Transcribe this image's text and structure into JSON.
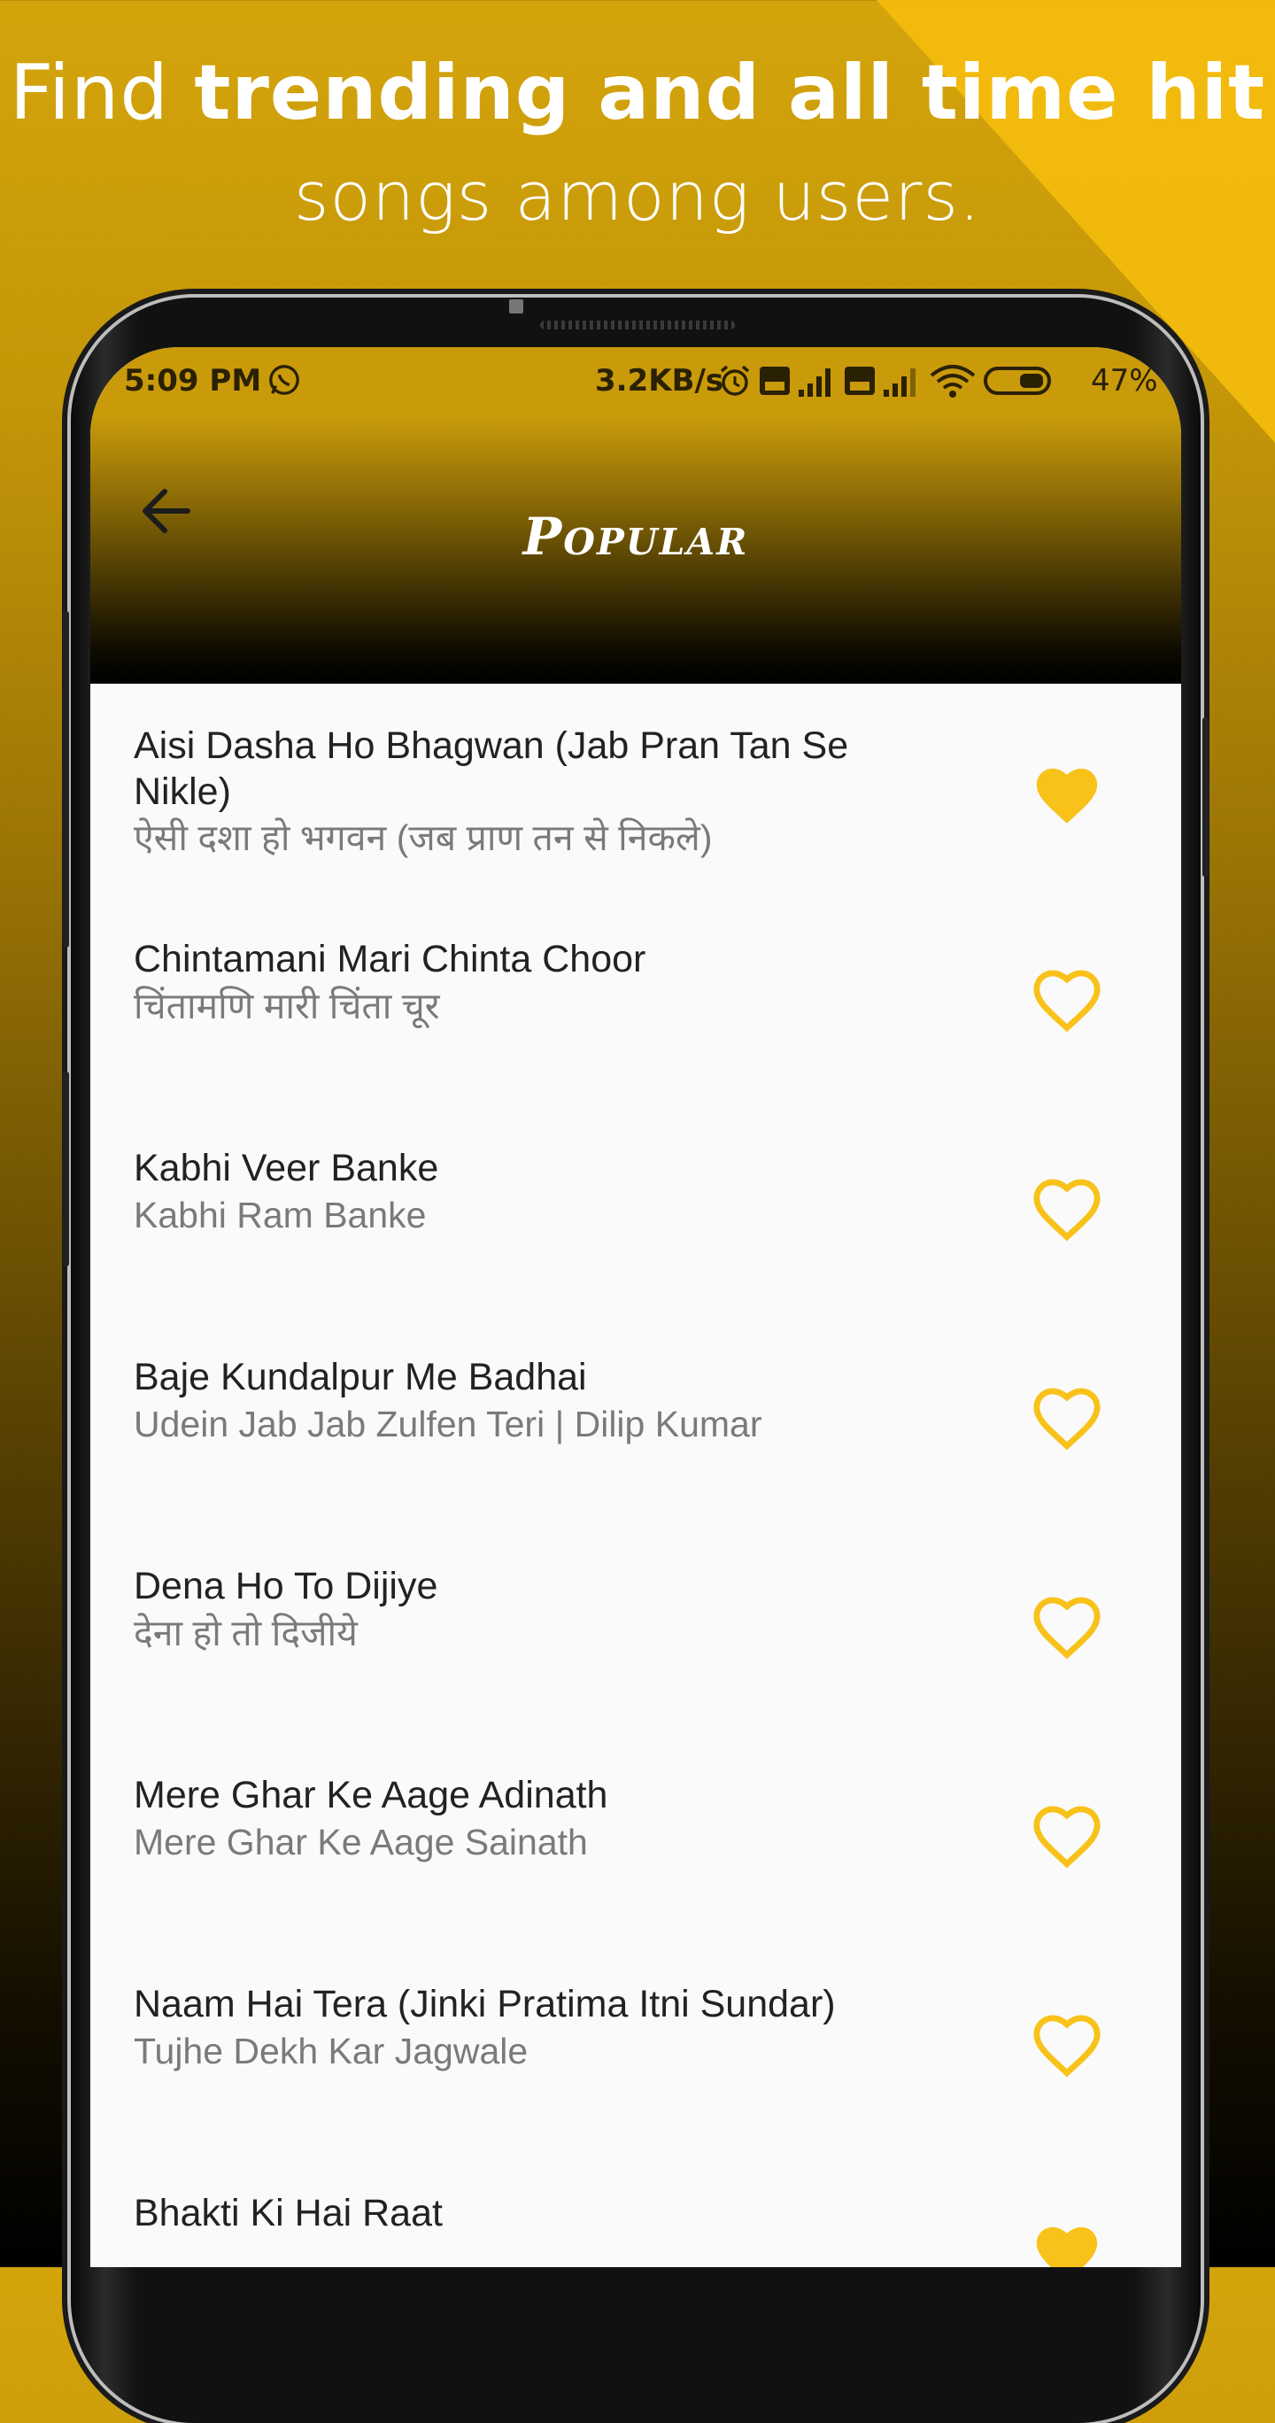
{
  "headline": {
    "line1_light": "Find ",
    "line1_bold": "trending and all time hit",
    "line2": "songs among users."
  },
  "status_bar": {
    "time": "5:09 PM",
    "net_speed": "3.2KB/s",
    "battery": "47%",
    "icons": [
      "whatsapp-icon",
      "alarm-icon",
      "volte-icon",
      "signal-icon",
      "volte-icon",
      "signal-icon",
      "wifi-icon",
      "battery-icon"
    ]
  },
  "app_bar": {
    "title": "Popular",
    "back_icon": "arrow-left-icon"
  },
  "colors": {
    "accent": "#F8C21A",
    "title_text": "#222222",
    "subtitle_text": "#7A7A7A"
  },
  "songs": [
    {
      "title": "Aisi Dasha Ho Bhagwan (Jab Pran Tan Se Nikle)",
      "subtitle": "ऐसी दशा हो भगवन (जब प्राण तन से निकले)",
      "favorite": true
    },
    {
      "title": "Chintamani Mari Chinta Choor",
      "subtitle": "चिंतामणि मारी चिंता चूर",
      "favorite": false
    },
    {
      "title": "Kabhi Veer Banke",
      "subtitle": "Kabhi Ram Banke",
      "favorite": false
    },
    {
      "title": "Baje Kundalpur Me Badhai",
      "subtitle": "Udein Jab Jab Zulfen Teri | Dilip Kumar",
      "favorite": false
    },
    {
      "title": "Dena Ho To Dijiye",
      "subtitle": "देना हो तो दिजीये",
      "favorite": false
    },
    {
      "title": "Mere Ghar Ke Aage Adinath",
      "subtitle": "Mere Ghar Ke Aage Sainath",
      "favorite": false
    },
    {
      "title": "Naam Hai Tera (Jinki Pratima Itni Sundar)",
      "subtitle": "Tujhe Dekh Kar Jagwale",
      "favorite": false
    },
    {
      "title": "Bhakti Ki Hai Raat",
      "subtitle": "",
      "favorite": true
    }
  ]
}
